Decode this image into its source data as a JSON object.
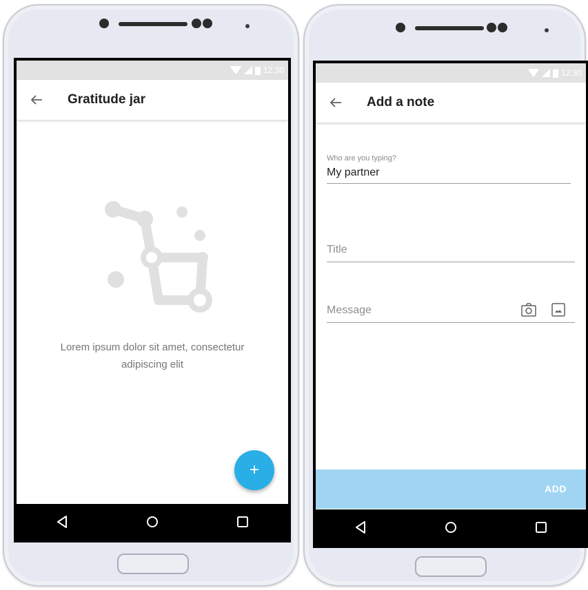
{
  "left_phone": {
    "status_time": "12:30",
    "title": "Gratitude jar",
    "empty_message": "Lorem ipsum dolor sit amet, consectetur adipiscing elit",
    "fab_icon": "plus-icon",
    "fab_label": "+",
    "nav_icons": [
      "back-triangle-icon",
      "home-circle-icon",
      "recents-square-icon"
    ]
  },
  "right_phone": {
    "status_time": "12:30",
    "title": "Add a note",
    "recipient_label": "Who are you typing?",
    "recipient_value": "My partner",
    "title_placeholder": "Title",
    "message_placeholder": "Message",
    "message_icons": [
      "camera-icon",
      "image-icon"
    ],
    "add_button_label": "ADD",
    "nav_icons": [
      "back-triangle-icon",
      "home-circle-icon",
      "recents-square-icon"
    ]
  },
  "colors": {
    "fab": "#29aee6",
    "add_bar": "#9fd5f3",
    "status_bar": "#e2e2e2",
    "device_body": "#e6e9f1"
  }
}
